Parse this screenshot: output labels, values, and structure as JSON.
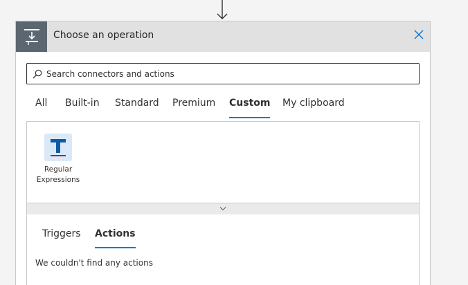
{
  "header": {
    "title": "Choose an operation",
    "icon": "operation-icon",
    "close_icon": "close-icon"
  },
  "search": {
    "placeholder": "Search connectors and actions",
    "value": ""
  },
  "tabs": [
    {
      "label": "All",
      "active": false
    },
    {
      "label": "Built-in",
      "active": false
    },
    {
      "label": "Standard",
      "active": false
    },
    {
      "label": "Premium",
      "active": false
    },
    {
      "label": "Custom",
      "active": true
    },
    {
      "label": "My clipboard",
      "active": false
    }
  ],
  "connectors": [
    {
      "label_line1": "Regular",
      "label_line2": "Expressions",
      "icon": "regex-t-icon"
    }
  ],
  "subtabs": [
    {
      "label": "Triggers",
      "active": false
    },
    {
      "label": "Actions",
      "active": true
    }
  ],
  "empty_message": "We couldn't find any actions",
  "colors": {
    "accent": "#0078d4",
    "header_bg": "#e1e1e1",
    "header_icon_bg": "#5c6670",
    "connector_icon_bg": "#d9e9f7",
    "connector_icon_fg": "#0f5aa3"
  }
}
